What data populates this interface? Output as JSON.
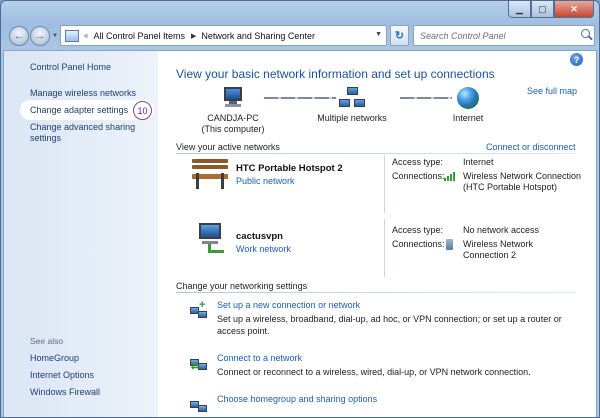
{
  "window": {
    "caption_buttons": [
      "minimize-icon",
      "maximize-icon",
      "close-icon"
    ]
  },
  "address_bar": {
    "overflow_glyph": "«",
    "crumbs": [
      "All Control Panel Items",
      "Network and Sharing Center"
    ],
    "search_placeholder": "Search Control Panel"
  },
  "sidebar": {
    "home": "Control Panel Home",
    "links": [
      "Manage wireless networks",
      "Change adapter settings",
      "Change advanced sharing settings"
    ],
    "step_badge": "10",
    "see_also_label": "See also",
    "see_also": [
      "HomeGroup",
      "Internet Options",
      "Windows Firewall"
    ]
  },
  "main": {
    "help": "?",
    "title": "View your basic network information and set up connections",
    "see_full_map": "See full map",
    "map": {
      "computer_name": "CANDJA-PC",
      "computer_sub": "(This computer)",
      "middle": "Multiple networks",
      "internet": "Internet"
    },
    "active_networks_title": "View your active networks",
    "connect_disconnect": "Connect or disconnect",
    "access_type_label": "Access type:",
    "connections_label": "Connections:",
    "networks": [
      {
        "name": "HTC Portable Hotspot  2",
        "type": "Public network",
        "access_type": "Internet",
        "connection": "Wireless Network Connection (HTC Portable Hotspot)"
      },
      {
        "name": "cactusvpn",
        "type": "Work network",
        "access_type": "No network access",
        "connection": "Wireless Network Connection 2"
      }
    ],
    "change_settings_title": "Change your networking settings",
    "tasks": [
      {
        "label": "Set up a new connection or network",
        "description": "Set up a wireless, broadband, dial-up, ad hoc, or VPN connection; or set up a router or access point."
      },
      {
        "label": "Connect to a network",
        "description": "Connect or reconnect to a wireless, wired, dial-up, or VPN network connection."
      },
      {
        "label": "Choose homegroup and sharing options",
        "description": ""
      }
    ]
  }
}
